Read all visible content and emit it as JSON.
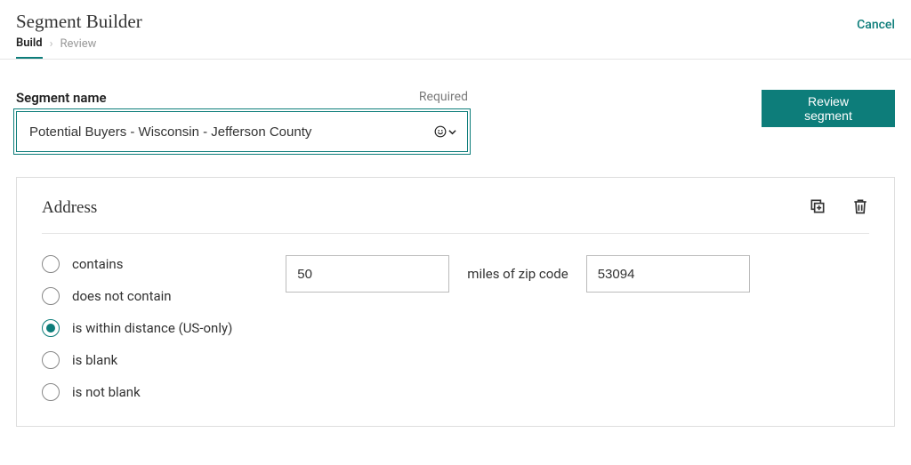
{
  "header": {
    "title": "Segment Builder",
    "breadcrumb": {
      "build": "Build",
      "review": "Review"
    },
    "cancel": "Cancel"
  },
  "segmentName": {
    "label": "Segment name",
    "required": "Required",
    "value": "Potential Buyers - Wisconsin - Jefferson County"
  },
  "actions": {
    "reviewSegment": "Review segment"
  },
  "addressCard": {
    "title": "Address",
    "options": {
      "contains": "contains",
      "doesNotContain": "does not contain",
      "withinDistance": "is within distance (US-only)",
      "isBlank": "is blank",
      "isNotBlank": "is not blank"
    },
    "selected": "withinDistance",
    "distance": {
      "miles": "50",
      "label": "miles of zip code",
      "zip": "53094"
    }
  }
}
